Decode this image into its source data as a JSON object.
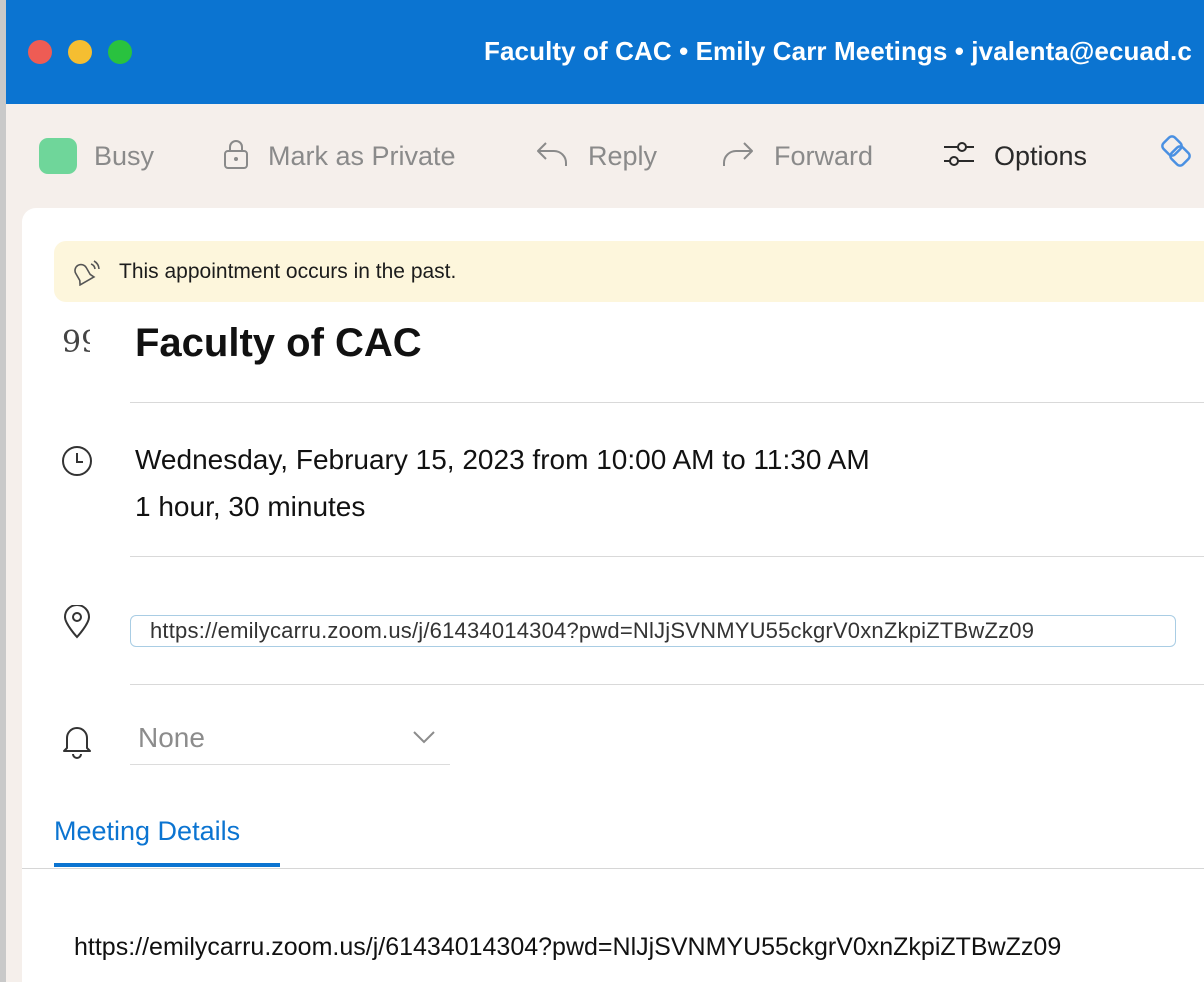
{
  "window": {
    "title": "Faculty of CAC • Emily Carr Meetings • jvalenta@ecuad.c"
  },
  "toolbar": {
    "busy_label": "Busy",
    "busy_color": "#6fd69a",
    "private_label": "Mark as Private",
    "reply_label": "Reply",
    "forward_label": "Forward",
    "options_label": "Options"
  },
  "banner": {
    "text": "This appointment occurs in the past."
  },
  "event": {
    "subject": "Faculty of CAC",
    "when_line1": "Wednesday, February 15, 2023 from 10:00 AM to 11:30 AM",
    "when_line2": "1 hour, 30 minutes",
    "location": "https://emilycarru.zoom.us/j/61434014304?pwd=NlJjSVNMYU55ckgrV0xnZkpiZTBwZz09",
    "reminder": "None"
  },
  "tabs": {
    "details_label": "Meeting Details"
  },
  "details": {
    "body_link": "https://emilycarru.zoom.us/j/61434014304?pwd=NlJjSVNMYU55ckgrV0xnZkpiZTBwZz09"
  },
  "colors": {
    "accent": "#0b74d1",
    "banner_bg": "#fdf6dc"
  }
}
